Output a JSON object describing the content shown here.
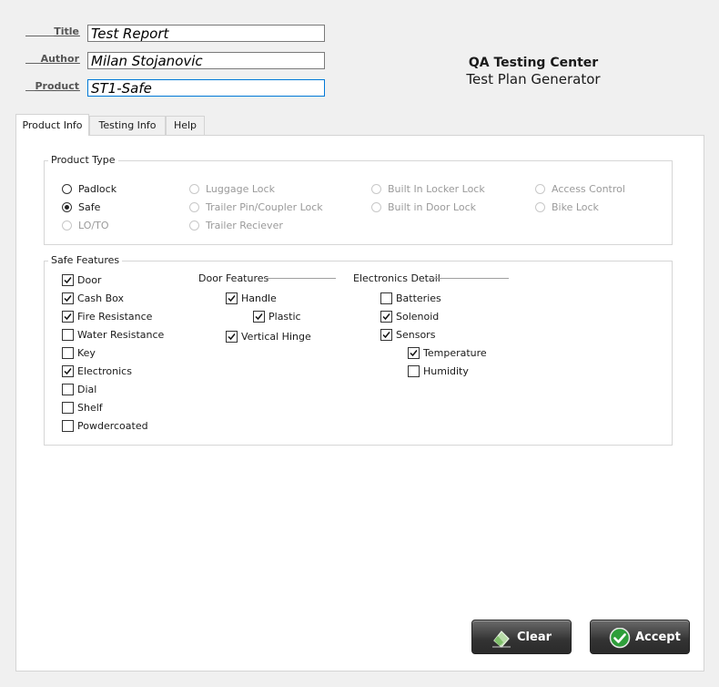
{
  "form": {
    "title_label": "Title",
    "title_value": "Test Report",
    "author_label": "Author",
    "author_value": "Milan Stojanovic",
    "product_label": "Product",
    "product_value": "ST1-Safe"
  },
  "brand": {
    "name": "QA Testing Center",
    "subtitle": "Test Plan Generator"
  },
  "tabs": [
    {
      "label": "Product Info",
      "active": true
    },
    {
      "label": "Testing Info",
      "active": false
    },
    {
      "label": "Help",
      "active": false
    }
  ],
  "product_type": {
    "title": "Product Type",
    "options": [
      {
        "label": "Padlock",
        "checked": false,
        "enabled": true
      },
      {
        "label": "Safe",
        "checked": true,
        "enabled": true
      },
      {
        "label": "LO/TO",
        "checked": false,
        "enabled": false
      },
      {
        "label": "Luggage Lock",
        "checked": false,
        "enabled": false
      },
      {
        "label": "Trailer Pin/Coupler Lock",
        "checked": false,
        "enabled": false
      },
      {
        "label": "Trailer Reciever",
        "checked": false,
        "enabled": false
      },
      {
        "label": "Built In Locker Lock",
        "checked": false,
        "enabled": false
      },
      {
        "label": "Built in Door Lock",
        "checked": false,
        "enabled": false
      },
      {
        "label": "Access Control",
        "checked": false,
        "enabled": false
      },
      {
        "label": "Bike Lock",
        "checked": false,
        "enabled": false
      }
    ]
  },
  "safe_features": {
    "title": "Safe Features",
    "items": [
      {
        "label": "Door",
        "checked": true
      },
      {
        "label": "Cash Box",
        "checked": true
      },
      {
        "label": "Fire Resistance",
        "checked": true
      },
      {
        "label": "Water Resistance",
        "checked": false
      },
      {
        "label": "Key",
        "checked": false
      },
      {
        "label": "Electronics",
        "checked": true
      },
      {
        "label": "Dial",
        "checked": false
      },
      {
        "label": "Shelf",
        "checked": false
      },
      {
        "label": "Powdercoated",
        "checked": false
      }
    ],
    "door_features": {
      "title": "Door Features",
      "items": [
        {
          "label": "Handle",
          "checked": true
        },
        {
          "label": "Plastic",
          "checked": true
        },
        {
          "label": "Vertical Hinge",
          "checked": true
        }
      ]
    },
    "electronics_detail": {
      "title": "Electronics Detail",
      "items": [
        {
          "label": "Batteries",
          "checked": false
        },
        {
          "label": "Solenoid",
          "checked": true
        },
        {
          "label": "Sensors",
          "checked": true
        },
        {
          "label": "Temperature",
          "checked": true
        },
        {
          "label": "Humidity",
          "checked": false
        }
      ]
    }
  },
  "buttons": {
    "clear_label": "Clear",
    "accept_label": "Accept"
  },
  "colors": {
    "accept_icon": "#2e9e3a",
    "focus_border": "#0078d7"
  }
}
